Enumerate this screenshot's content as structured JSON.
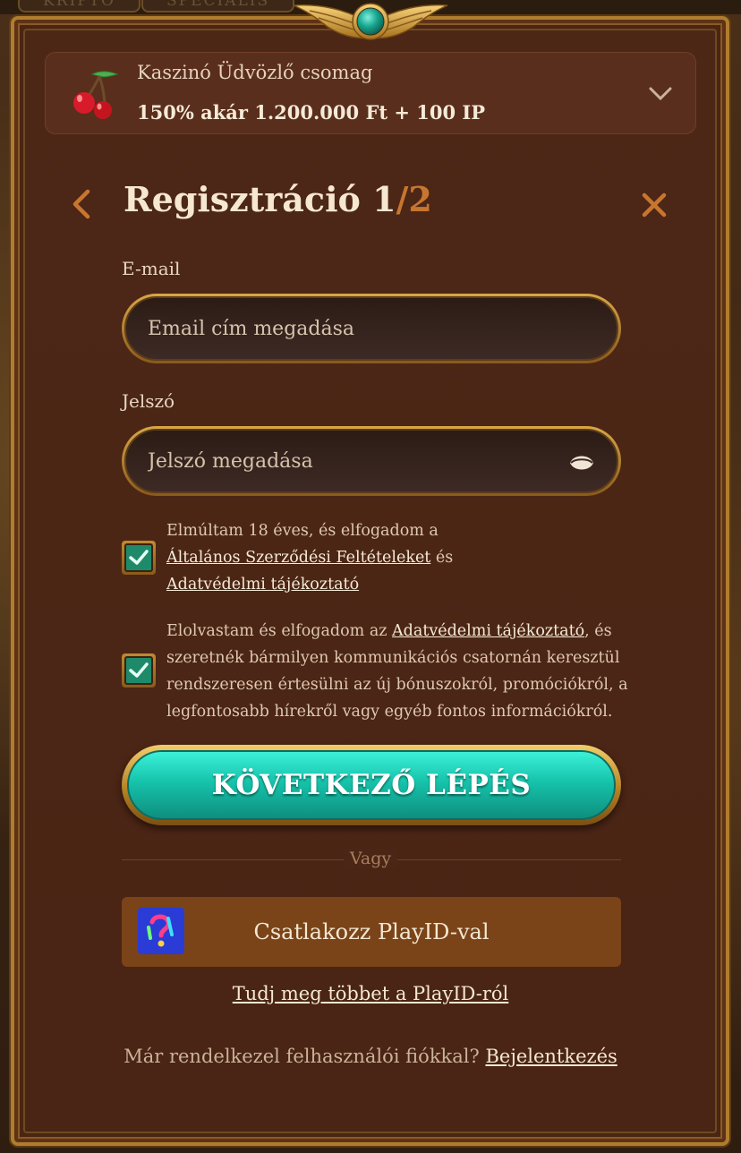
{
  "background_tabs": [
    "KRIPTO",
    "SPECIÁLIS"
  ],
  "promo": {
    "title": "Kaszinó Üdvözlő csomag",
    "value": "150% akár 1.200.000 Ft + 100 IP",
    "icon": "cherries-icon"
  },
  "header": {
    "title_main": "Regisztráció 1",
    "title_total": "/2"
  },
  "form": {
    "email_label": "E-mail",
    "email_placeholder": "Email cím megadása",
    "password_label": "Jelszó",
    "password_placeholder": "Jelszó megadása"
  },
  "consent1": {
    "checked": true,
    "text_before": "Elmúltam 18 éves, és elfogadom a ",
    "link1": "Általános Szerződési Feltételeket",
    "text_mid": " és ",
    "link2": "Adatvédelmi tájékoztató"
  },
  "consent2": {
    "checked": true,
    "text_before": "Elolvastam és elfogadom az ",
    "link": "Adatvédelmi tájékoztató",
    "text_after": ", és szeretnék bármilyen kommunikációs csatornán keresztül rendszeresen értesülni az új bónuszokról, promóciókról, a legfontosabb hírekről vagy egyéb fontos információkról."
  },
  "next_button": "KÖVETKEZŐ LÉPÉS",
  "divider_text": "Vagy",
  "playid_button": "Csatlakozz PlayID-val",
  "learn_more": "Tudj meg többet a PlayID-ról",
  "login": {
    "prompt": "Már rendelkezel felhasználói fiókkal?",
    "link": "Bejelentkezés"
  },
  "colors": {
    "modal_bg": "#4a2514",
    "gold_border": "#b07d2e",
    "accent_orange": "#c7762f",
    "teal_button": "#16c3ab",
    "checkbox_green": "#1e8a6a"
  }
}
